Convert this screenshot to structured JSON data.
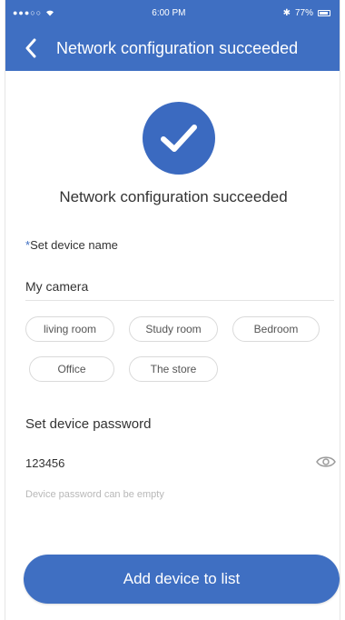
{
  "status_bar": {
    "signal": "●●●○○",
    "time": "6:00 PM",
    "bluetooth": "✱",
    "battery_pct": "77%"
  },
  "nav": {
    "back_icon": "chevron-left-icon",
    "title": "Network configuration succeeded"
  },
  "success": {
    "icon": "check-circle-icon",
    "message": "Network configuration succeeded"
  },
  "device_name": {
    "required_mark": "*",
    "label": "Set device name",
    "value": "My camera",
    "chips": [
      "living room",
      "Study room",
      "Bedroom",
      "Office",
      "The store"
    ]
  },
  "device_password": {
    "label": "Set device password",
    "value": "123456",
    "toggle_icon": "eye-icon",
    "hint": "Device password can be empty"
  },
  "primary_action": {
    "label": "Add device to list"
  },
  "colors": {
    "accent": "#3f6fc2",
    "text": "#333333",
    "hint": "#b8b8b8"
  }
}
